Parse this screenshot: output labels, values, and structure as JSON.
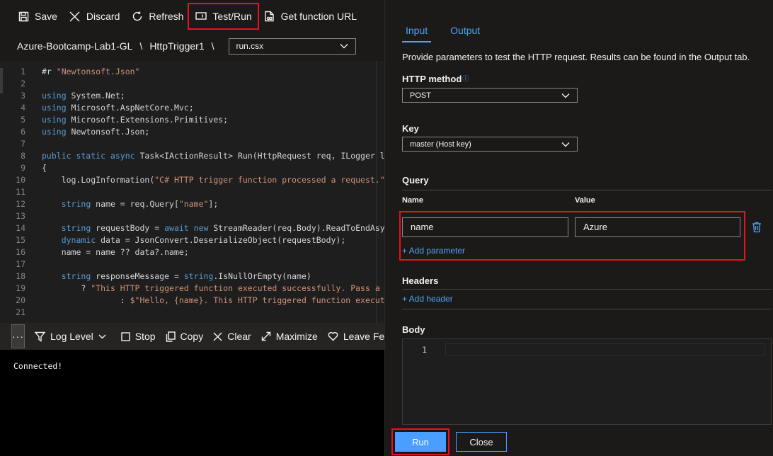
{
  "toolbar": {
    "save": "Save",
    "discard": "Discard",
    "refresh": "Refresh",
    "test_run": "Test/Run",
    "get_function_url": "Get function URL"
  },
  "breadcrumb": {
    "app": "Azure-Bootcamp-Lab1-GL",
    "sep": "\\",
    "function": "HttpTrigger1",
    "file": "run.csx"
  },
  "code_lines": [
    {
      "n": "1",
      "html": "#r <span class='str'>\"Newtonsoft.Json\"</span>"
    },
    {
      "n": "2",
      "html": ""
    },
    {
      "n": "3",
      "html": "<span class='kw'>using</span> System.Net;"
    },
    {
      "n": "4",
      "html": "<span class='kw'>using</span> Microsoft.AspNetCore.Mvc;"
    },
    {
      "n": "5",
      "html": "<span class='kw'>using</span> Microsoft.Extensions.Primitives;"
    },
    {
      "n": "6",
      "html": "<span class='kw'>using</span> Newtonsoft.Json;"
    },
    {
      "n": "7",
      "html": ""
    },
    {
      "n": "8",
      "html": "<span class='kw'>public static async</span> Task&lt;IActionResult&gt; Run(HttpRequest req, ILogger log)"
    },
    {
      "n": "9",
      "html": "{"
    },
    {
      "n": "10",
      "html": "    log.LogInformation(<span class='str'>\"C# HTTP trigger function processed a request.\"</span>);"
    },
    {
      "n": "11",
      "html": ""
    },
    {
      "n": "12",
      "html": "    <span class='kw'>string</span> name = req.Query[<span class='str'>\"name\"</span>];"
    },
    {
      "n": "13",
      "html": ""
    },
    {
      "n": "14",
      "html": "    <span class='kw'>string</span> requestBody = <span class='kw'>await new</span> StreamReader(req.Body).ReadToEndAsync();"
    },
    {
      "n": "15",
      "html": "    <span class='kw'>dynamic</span> data = JsonConvert.DeserializeObject(requestBody);"
    },
    {
      "n": "16",
      "html": "    name = name ?? data?.name;"
    },
    {
      "n": "17",
      "html": ""
    },
    {
      "n": "18",
      "html": "    <span class='kw'>string</span> responseMessage = <span class='kw'>string</span>.IsNullOrEmpty(name)"
    },
    {
      "n": "19",
      "html": "        ? <span class='str'>\"This HTTP triggered function executed successfully. Pass a name\"</span>"
    },
    {
      "n": "20",
      "html": "                : <span class='str'>$\"Hello, {name}. This HTTP triggered function executed successfully.\"</span>;"
    },
    {
      "n": "21",
      "html": ""
    }
  ],
  "console_bar": {
    "more": "···",
    "log_level": "Log Level",
    "stop": "Stop",
    "copy": "Copy",
    "clear": "Clear",
    "maximize": "Maximize",
    "leave_feedback": "Leave Feedb"
  },
  "console": {
    "output": "Connected!"
  },
  "panel": {
    "tabs": [
      "Input",
      "Output"
    ],
    "description": "Provide parameters to test the HTTP request. Results can be found in the Output tab.",
    "http_method_label": "HTTP method",
    "http_method_value": "POST",
    "key_label": "Key",
    "key_value": "master (Host key)",
    "query_label": "Query",
    "name_col": "Name",
    "value_col": "Value",
    "query_name": "name",
    "query_value": "Azure",
    "add_parameter": "+ Add parameter",
    "headers_label": "Headers",
    "add_header": "+ Add header",
    "body_label": "Body",
    "body_line": "1",
    "run": "Run",
    "close": "Close"
  },
  "colors": {
    "accent": "#4fa3f7",
    "highlight": "#e81123",
    "primary_button": "#4a9eff"
  }
}
